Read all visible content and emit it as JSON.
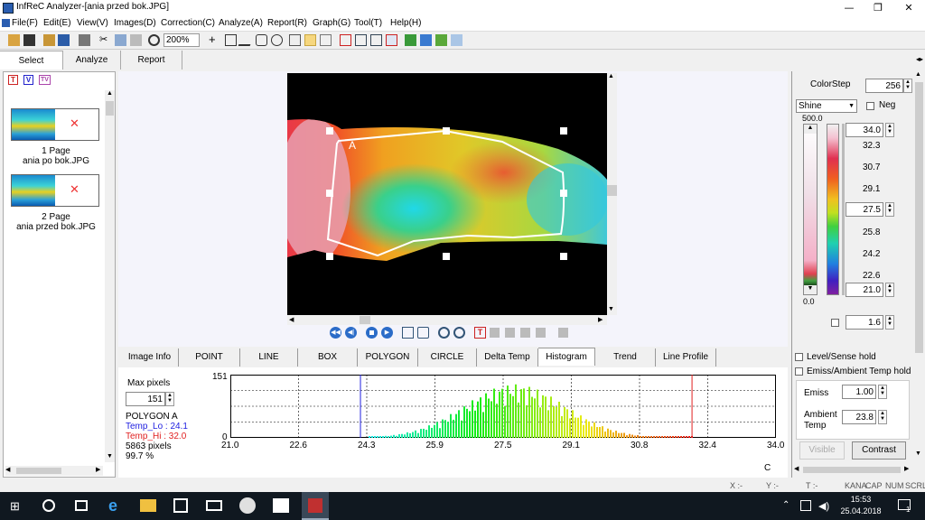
{
  "window": {
    "title": "InfReC Analyzer-[ania przed bok.JPG]"
  },
  "menu": [
    "File(F)",
    "Edit(E)",
    "View(V)",
    "Images(D)",
    "Correction(C)",
    "Analyze(A)",
    "Report(R)",
    "Graph(G)",
    "Tool(T)",
    "Help(H)"
  ],
  "toolbar": {
    "zoom": "200%"
  },
  "main_tabs": [
    "Select",
    "Analyze",
    "Report"
  ],
  "left": {
    "filter_icons": [
      "T",
      "V",
      "TV"
    ],
    "pages": [
      {
        "page": "1 Page",
        "file": "ania po bok.JPG"
      },
      {
        "page": "2 Page",
        "file": "ania przed bok.JPG"
      }
    ]
  },
  "image": {
    "roi_label": "A"
  },
  "bottom_tabs": [
    "Image Info",
    "POINT",
    "LINE",
    "BOX",
    "POLYGON",
    "CIRCLE",
    "Delta Temp",
    "Histogram",
    "Trend",
    "Line Profile"
  ],
  "histogram": {
    "max_pixels_label": "Max pixels",
    "max_pixels": "151",
    "roi": "POLYGON A",
    "temp_lo": "Temp_Lo : 24.1",
    "temp_hi": "Temp_Hi : 32.0",
    "pixels": "5863 pixels",
    "percent": "99.7 %",
    "unit": "C",
    "y_top": "151",
    "y_bottom": "0",
    "x_ticks": [
      "21.0",
      "22.6",
      "24.3",
      "25.9",
      "27.5",
      "29.1",
      "30.8",
      "32.4",
      "34.0"
    ]
  },
  "right": {
    "colorstep_label": "ColorStep",
    "colorstep": "256",
    "palette": "Shine",
    "neg_label": "Neg",
    "top_scale": "500.0",
    "bottom_scale": "0.0",
    "temp_max": "34.0",
    "temp_min": "21.0",
    "temp_mid": "27.5",
    "scale_labels": [
      "32.3",
      "30.7",
      "29.1",
      "25.8",
      "24.2",
      "22.6"
    ],
    "step_value": "1.6",
    "level_sense": "Level/Sense hold",
    "emiss_hold": "Emiss/Ambient Temp hold",
    "emiss_label": "Emiss",
    "emiss": "1.00",
    "ambient_label": "Ambient Temp",
    "ambient": "23.8",
    "visible_btn": "Visible",
    "contrast_btn": "Contrast"
  },
  "status": {
    "x": "X :-",
    "y": "Y :-",
    "t": "T :-",
    "kana": "KANA",
    "caps": "CAP",
    "num": "NUM",
    "scrl": "SCRL"
  },
  "taskbar": {
    "time": "15:53",
    "date": "25.04.2018",
    "notif": "1"
  }
}
